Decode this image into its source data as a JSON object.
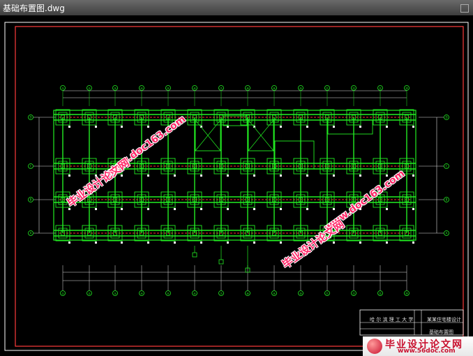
{
  "window": {
    "title": "基础布置图.dwg"
  },
  "drawing": {
    "grid_top_labels": [
      "①",
      "②",
      "③",
      "④",
      "⑤",
      "⑥",
      "⑦",
      "⑧",
      "⑨",
      "⑩",
      "⑪",
      "⑫",
      "⑬",
      "⑭"
    ],
    "grid_side_labels": [
      "D",
      "C",
      "B",
      "A"
    ],
    "colors": {
      "frame": "#ff3b3b",
      "structure": "#22ee22",
      "dim": "#dddddd",
      "hatch": "#ff2a2a"
    }
  },
  "title_block": {
    "school": "哈 尔 滨 理 工 大 学",
    "project": "某某住宅楼设计",
    "drawing_name": "基础布置图"
  },
  "watermarks": {
    "cn": "毕业设计论文网",
    "url": "www.doc163.com"
  },
  "logo": {
    "main": "毕业设计论文网",
    "sub": "www.56doc.com"
  }
}
